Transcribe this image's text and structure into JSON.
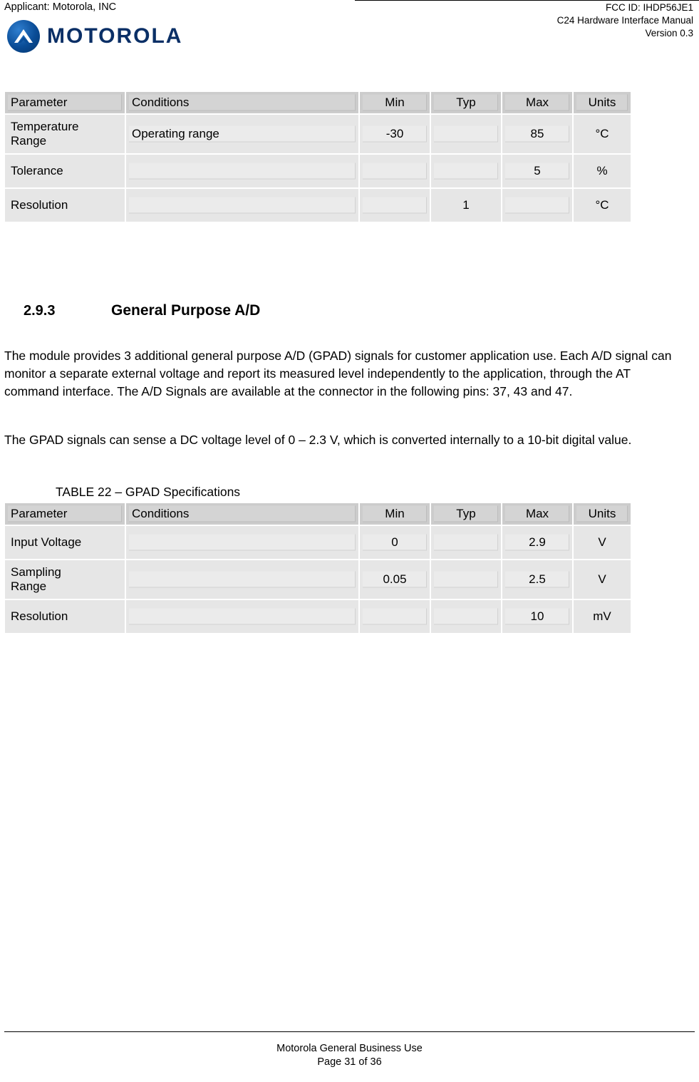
{
  "header": {
    "applicant": "Applicant: Motorola, INC",
    "fcc_id": "FCC ID: IHDP56JE1",
    "manual": "C24 Hardware Interface Manual",
    "version": "Version 0.3",
    "logo_wordmark": "MOTOROLA"
  },
  "table1": {
    "headers": [
      "Parameter",
      "Conditions",
      "Min",
      "Typ",
      "Max",
      "Units"
    ],
    "rows": [
      {
        "parameter": "Temperature\nRange",
        "conditions": "Operating range",
        "min": "-30",
        "typ": "",
        "max": "85",
        "units": "°C"
      },
      {
        "parameter": "Tolerance",
        "conditions": "",
        "min": "",
        "typ": "",
        "max": "5",
        "units": "%"
      },
      {
        "parameter": "Resolution",
        "conditions": "",
        "min": "",
        "typ": "1",
        "max": "",
        "units": "°C"
      }
    ]
  },
  "section": {
    "number": "2.9.3",
    "title": "General Purpose A/D",
    "paragraph1": "The module provides 3 additional general purpose A/D (GPAD) signals for customer application use. Each A/D signal can monitor a separate external voltage and report its measured level independently to the application, through the AT command interface. The A/D Signals are available at the connector in the following pins: 37, 43 and 47.",
    "paragraph2": "The GPAD signals can sense a DC voltage level of 0 – 2.3 V, which is converted internally to a 10-bit digital value.",
    "table_caption": "TABLE 22 – GPAD Specifications"
  },
  "table2": {
    "headers": [
      "Parameter",
      "Conditions",
      "Min",
      "Typ",
      "Max",
      "Units"
    ],
    "rows": [
      {
        "parameter": "Input Voltage",
        "conditions": "",
        "min": "0",
        "typ": "",
        "max": "2.9",
        "units": "V"
      },
      {
        "parameter": "Sampling\nRange",
        "conditions": "",
        "min": "0.05",
        "typ": "",
        "max": "2.5",
        "units": "V"
      },
      {
        "parameter": "Resolution",
        "conditions": "",
        "min": "",
        "typ": "",
        "max": "10",
        "units": "mV"
      }
    ]
  },
  "footer": {
    "line1": "Motorola General Business Use",
    "line2": "Page 31 of 36"
  }
}
